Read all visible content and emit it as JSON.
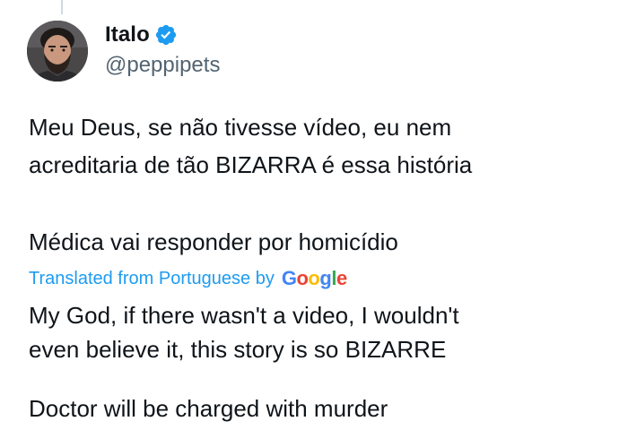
{
  "author": {
    "display_name": "Italo",
    "handle": "@peppipets",
    "verified": true,
    "verified_color": "#1d9bf0",
    "avatar_icon": "profile-photo"
  },
  "tweet": {
    "original_lines": [
      "Meu Deus, se não tivesse vídeo, eu nem",
      "acreditaria de tão BIZARRA é essa história",
      "Médica vai responder por homicídio"
    ],
    "translation_notice": "Translated from Portuguese by",
    "translation_provider": "Google",
    "translated_lines": [
      "My God, if there wasn't a video, I wouldn't",
      "even believe it, this story is so BIZARRE",
      "Doctor will be charged with murder"
    ]
  },
  "colors": {
    "text_primary": "#0f1419",
    "text_secondary": "#536471",
    "link": "#1d9bf0",
    "thread_line": "#cfd9de"
  }
}
